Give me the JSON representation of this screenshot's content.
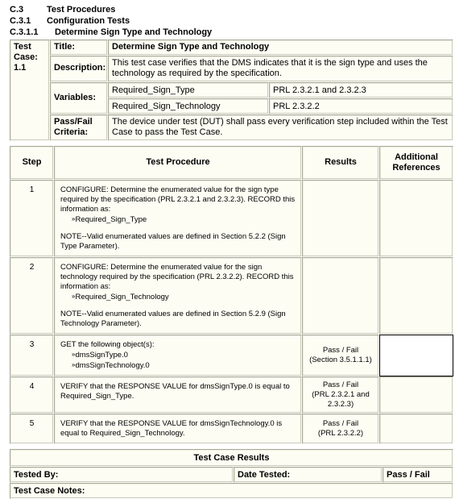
{
  "headings": [
    {
      "number": "C.3",
      "text": "Test Procedures",
      "level": 1
    },
    {
      "number": "C.3.1",
      "text": "Configuration Tests",
      "level": 2
    },
    {
      "number": "C.3.1.1",
      "text": "Determine Sign Type and Technology",
      "level": 3
    }
  ],
  "test_case": {
    "label": "Test Case:",
    "number": "1.1",
    "title_label": "Title:",
    "title_value": "Determine Sign Type and Technology",
    "description_label": "Description:",
    "description_value": "This test case verifies that the DMS indicates that it is the sign type and uses the technology as required by the specification.",
    "variables_label": "Variables:",
    "variables": [
      {
        "name": "Required_Sign_Type",
        "reference": "PRL 2.3.2.1 and 2.3.2.3"
      },
      {
        "name": "Required_Sign_Technology",
        "reference": "PRL 2.3.2.2"
      }
    ],
    "passfail_label": "Pass/Fail Criteria:",
    "passfail_value": "The device under test (DUT) shall pass every verification step included within the Test Case to pass the Test Case."
  },
  "steps_table": {
    "columns": [
      "Step",
      "Test Procedure",
      "Results",
      "Additional References"
    ],
    "rows": [
      {
        "step": "1",
        "procedure_main": "CONFIGURE: Determine the enumerated value for the sign type required by the specification (PRL 2.3.2.1 and 2.3.2.3). RECORD this information as:",
        "procedure_item": "Required_Sign_Type",
        "procedure_note": "NOTE--Valid enumerated values are defined in Section 5.2.2 (Sign Type Parameter).",
        "results": "",
        "results_ref": "",
        "additional_references": "",
        "selected": false
      },
      {
        "step": "2",
        "procedure_main": "CONFIGURE: Determine the enumerated value for the sign technology required by the specification (PRL 2.3.2.2). RECORD this information as:",
        "procedure_item": "Required_Sign_Technology",
        "procedure_note": "NOTE--Valid enumerated values are defined in Section 5.2.9 (Sign Technology Parameter).",
        "results": "",
        "results_ref": "",
        "additional_references": "",
        "selected": false
      },
      {
        "step": "3",
        "procedure_main": "GET the following object(s):",
        "procedure_item": "dmsSignType.0",
        "procedure_item2": "dmsSignTechnology.0",
        "procedure_note": "",
        "results": "Pass / Fail",
        "results_ref": "(Section 3.5.1.1.1)",
        "additional_references": "",
        "selected": true
      },
      {
        "step": "4",
        "procedure_main": "VERIFY that the RESPONSE VALUE for dmsSignType.0 is equal to Required_Sign_Type.",
        "procedure_item": "",
        "procedure_note": "",
        "results": "Pass / Fail",
        "results_ref": "(PRL 2.3.2.1 and 2.3.2.3)",
        "additional_references": "",
        "selected": false
      },
      {
        "step": "5",
        "procedure_main": "VERIFY that the RESPONSE VALUE for dmsSignTechnology.0 is equal to Required_Sign_Technology.",
        "procedure_item": "",
        "procedure_note": "",
        "results": "Pass / Fail",
        "results_ref": "(PRL 2.3.2.2)",
        "additional_references": "",
        "selected": false
      }
    ]
  },
  "footer": {
    "results_title": "Test Case Results",
    "tested_by_label": "Tested By:",
    "tested_by_value": "",
    "date_tested_label": "Date Tested:",
    "date_tested_value": "",
    "passfail_label": "Pass / Fail",
    "notes_label": "Test Case Notes:",
    "notes_value": ""
  },
  "bullet_glyph": "»"
}
